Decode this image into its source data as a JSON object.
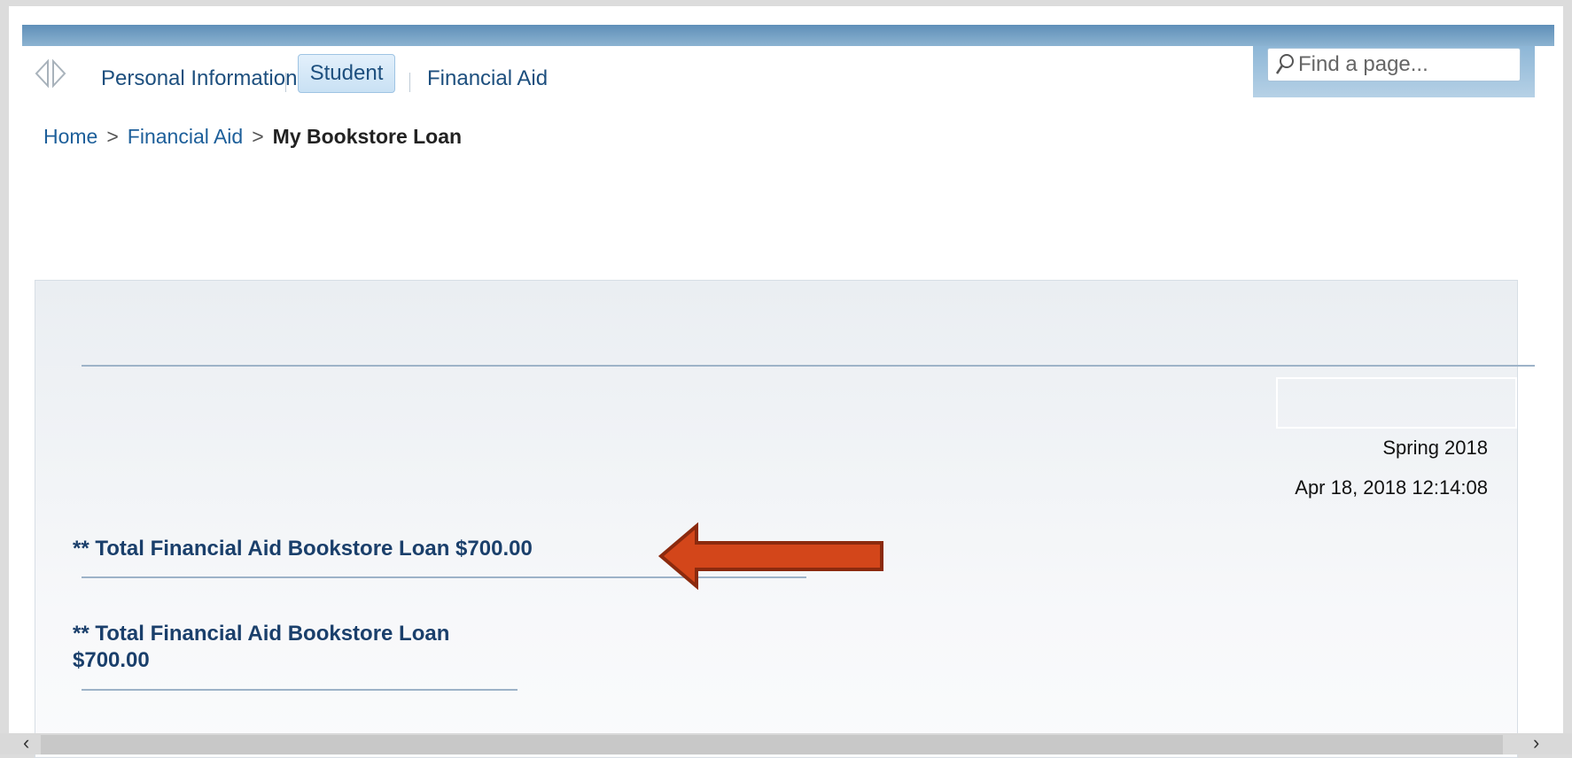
{
  "nav": {
    "items": [
      "Personal Information",
      "Student",
      "Financial Aid"
    ],
    "active": "Student"
  },
  "search": {
    "placeholder": "Find a page..."
  },
  "breadcrumb": {
    "home": "Home",
    "parent": "Financial Aid",
    "current": "My Bookstore Loan",
    "separator": ">"
  },
  "report": {
    "term": "Spring 2018",
    "timestamp": "Apr 18, 2018 12:14:08",
    "loan_line_1": "** Total Financial Aid Bookstore Loan $700.00",
    "loan_line_2": "** Total Financial Aid Bookstore Loan $700.00"
  },
  "colors": {
    "arrow_fill": "#d3461a",
    "arrow_stroke": "#8b2a0e",
    "link": "#1d4f7e"
  }
}
